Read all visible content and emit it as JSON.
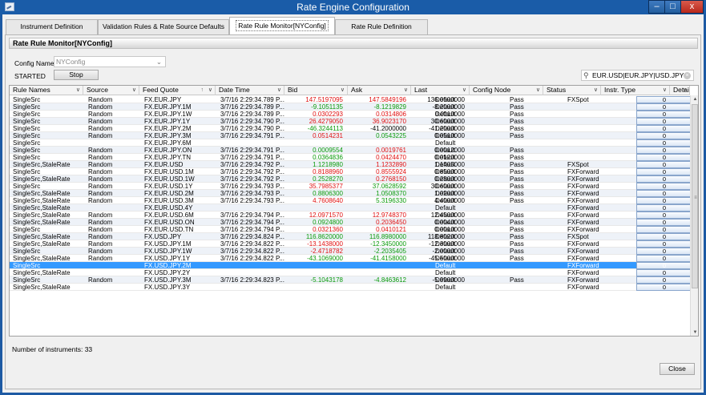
{
  "window": {
    "title": "Rate Engine Configuration",
    "min": "–",
    "max": "□",
    "close": "x"
  },
  "tabs": [
    {
      "label": "Instrument Definition"
    },
    {
      "label": "Validation Rules & Rate Source Defaults"
    },
    {
      "label": "Rate Rule Monitor[NYConfig]"
    },
    {
      "label": "Rate Rule Definition"
    }
  ],
  "panel": {
    "title": "Rate Rule Monitor[NYConfig]",
    "config_label": "Config Name",
    "config_value": "NYConfig",
    "status": "STARTED",
    "stop_label": "Stop",
    "search_value": "EUR.USD|EUR.JPY|USD.JPY"
  },
  "columns": [
    "Rule Names",
    "Source",
    "Feed Quote",
    "Date Time",
    "Bid",
    "Ask",
    "Last",
    "Config Node",
    "Status",
    "Instr. Type",
    "Details"
  ],
  "rows": [
    [
      "SingleSrc",
      "Random",
      "FX.EUR.JPY",
      "3/7/16 2:29:34.789 P...",
      "147.5197095",
      "147.5849196",
      "136.0600000",
      "Default",
      "Pass",
      "FXSpot",
      "0"
    ],
    [
      "SingleSrc",
      "Random",
      "FX.EUR.JPY.1M",
      "3/7/16 2:29:34.789 P...",
      "-9.1051135",
      "-8.1219829",
      "-8.2000000",
      "Default",
      "Pass",
      "",
      "0"
    ],
    [
      "SingleSrc",
      "Random",
      "FX.EUR.JPY.1W",
      "3/7/16 2:29:34.789 P...",
      "0.0302293",
      "0.0314806",
      "0.0110000",
      "Default",
      "Pass",
      "",
      "0"
    ],
    [
      "SingleSrc",
      "Random",
      "FX.EUR.JPY.1Y",
      "3/7/16 2:29:34.790 P...",
      "26.4279050",
      "36.9023170",
      "30.6000000",
      "Default",
      "Pass",
      "",
      "0"
    ],
    [
      "SingleSrc",
      "Random",
      "FX.EUR.JPY.2M",
      "3/7/16 2:29:34.790 P...",
      "-46.3244113",
      "-41.2000000",
      "-41.2000000",
      "Default",
      "Pass",
      "",
      "0"
    ],
    [
      "SingleSrc",
      "Random",
      "FX.EUR.JPY.3M",
      "3/7/16 2:29:34.791 P...",
      "0.0514231",
      "0.0543225",
      "0.0510000",
      "Default",
      "Pass",
      "",
      "0"
    ],
    [
      "SingleSrc",
      "",
      "FX.EUR.JPY.6M",
      "",
      "",
      "",
      "",
      "Default",
      "",
      "",
      "0"
    ],
    [
      "SingleSrc",
      "Random",
      "FX.EUR.JPY.ON",
      "3/7/16 2:29:34.791 P...",
      "0.0009554",
      "0.0019761",
      "0.0012000",
      "Default",
      "Pass",
      "",
      "0"
    ],
    [
      "SingleSrc",
      "Random",
      "FX.EUR.JPY.TN",
      "3/7/16 2:29:34.791 P...",
      "0.0364836",
      "0.0424470",
      "0.0120000",
      "Default",
      "Pass",
      "",
      "0"
    ],
    [
      "SingleSrc,StaleRate",
      "Random",
      "FX.EUR.USD",
      "3/7/16 2:29:34.792 P...",
      "1.1218980",
      "1.1232890",
      "1.1405000",
      "Default",
      "Pass",
      "FXSpot",
      "0"
    ],
    [
      "SingleSrc",
      "Random",
      "FX.EUR.USD.1M",
      "3/7/16 2:29:34.792 P...",
      "0.8188960",
      "0.8555924",
      "0.8500000",
      "Default",
      "Pass",
      "FXForward",
      "0"
    ],
    [
      "SingleSrc,StaleRate",
      "Random",
      "FX.EUR.USD.1W",
      "3/7/16 2:29:34.792 P...",
      "0.2528270",
      "0.2768150",
      "0.2800000",
      "Default",
      "Pass",
      "FXForward",
      "0"
    ],
    [
      "SingleSrc",
      "Random",
      "FX.EUR.USD.1Y",
      "3/7/16 2:29:34.793 P...",
      "35.7985377",
      "37.0628592",
      "30.6000000",
      "Default",
      "Pass",
      "FXForward",
      "0"
    ],
    [
      "SingleSrc,StaleRate",
      "Random",
      "FX.EUR.USD.2M",
      "3/7/16 2:29:34.793 P...",
      "0.8806300",
      "1.0508370",
      "1.0200000",
      "Default",
      "Pass",
      "FXForward",
      "0"
    ],
    [
      "SingleSrc,StaleRate",
      "Random",
      "FX.EUR.USD.3M",
      "3/7/16 2:29:34.793 P...",
      "4.7608640",
      "5.3196330",
      "4.4000000",
      "Default",
      "Pass",
      "FXForward",
      "0"
    ],
    [
      "SingleSrc,StaleRate",
      "",
      "FX.EUR.USD.4Y",
      "",
      "",
      "",
      "",
      "Default",
      "",
      "FXForward",
      "0"
    ],
    [
      "SingleSrc,StaleRate",
      "Random",
      "FX.EUR.USD.6M",
      "3/7/16 2:29:34.794 P...",
      "12.0971570",
      "12.9748370",
      "12.4500000",
      "Default",
      "Pass",
      "FXForward",
      "0"
    ],
    [
      "SingleSrc,StaleRate",
      "Random",
      "FX.EUR.USD.ON",
      "3/7/16 2:29:34.794 P...",
      "0.0924800",
      "0.2036450",
      "0.0040000",
      "Default",
      "Pass",
      "FXForward",
      "0"
    ],
    [
      "SingleSrc",
      "Random",
      "FX.EUR.USD.TN",
      "3/7/16 2:29:34.794 P...",
      "0.0321360",
      "0.0410121",
      "0.0010000",
      "Default",
      "Pass",
      "FXForward",
      "0"
    ],
    [
      "SingleSrc,StaleRate",
      "Random",
      "FX.USD.JPY",
      "3/7/16 2:29:34.824 P...",
      "116.8620000",
      "116.8980000",
      "118.8020000",
      "Default",
      "Pass",
      "FXSpot",
      "0"
    ],
    [
      "SingleSrc,StaleRate",
      "Random",
      "FX.USD.JPY.1M",
      "3/7/16 2:29:34.822 P...",
      "-13.1438000",
      "-12.3450000",
      "-12.3000000",
      "Default",
      "Pass",
      "FXForward",
      "0"
    ],
    [
      "SingleSrc",
      "Random",
      "FX.USD.JPY.1W",
      "3/7/16 2:29:34.822 P...",
      "-2.4718782",
      "-2.2035405",
      "-2.0000000",
      "Default",
      "Pass",
      "FXForward",
      "0"
    ],
    [
      "SingleSrc,StaleRate",
      "Random",
      "FX.USD.JPY.1Y",
      "3/7/16 2:29:34.822 P...",
      "-43.1069000",
      "-41.4158000",
      "-45.5000000",
      "Default",
      "Pass",
      "FXForward",
      "0"
    ],
    [
      "SingleSrc",
      "",
      "FX.USD.JPY.2M",
      "",
      "",
      "",
      "",
      "Default",
      "",
      "FXForward",
      "0"
    ],
    [
      "SingleSrc,StaleRate",
      "",
      "FX.USD.JPY.2Y",
      "",
      "",
      "",
      "",
      "Default",
      "",
      "FXForward",
      "0"
    ],
    [
      "SingleSrc",
      "Random",
      "FX.USD.JPY.3M",
      "3/7/16 2:29:34.823 P...",
      "-5.1043178",
      "-4.8463612",
      "-5.9900000",
      "Default",
      "Pass",
      "FXForward",
      "0"
    ],
    [
      "SingleSrc,StaleRate",
      "",
      "FX.USD.JPY.3Y",
      "",
      "",
      "",
      "",
      "Default",
      "",
      "FXForward",
      "0"
    ]
  ],
  "selected_row": 23,
  "rate_colors": {
    "bid": [
      "neg",
      "pos",
      "neg",
      "neg",
      "pos",
      "neg",
      "",
      "pos",
      "pos",
      "pos",
      "neg",
      "pos",
      "neg",
      "pos",
      "neg",
      "",
      "neg",
      "pos",
      "neg",
      "pos",
      "neg",
      "neg",
      "pos",
      "",
      "",
      "pos",
      ""
    ],
    "ask": [
      "neg",
      "pos",
      "neg",
      "neg",
      "",
      "pos",
      "",
      "neg",
      "neg",
      "neg",
      "neg",
      "neg",
      "pos",
      "pos",
      "pos",
      "",
      "neg",
      "neg",
      "neg",
      "pos",
      "pos",
      "pos",
      "pos",
      "",
      "",
      "pos",
      ""
    ]
  },
  "footer": {
    "count_text": "Number of instruments: 33",
    "close_label": "Close"
  },
  "colors": {
    "selection": "#3399ff",
    "positive": "#0a9a0a",
    "negative": "#e01010",
    "title_bar": "#1a5ca8"
  }
}
